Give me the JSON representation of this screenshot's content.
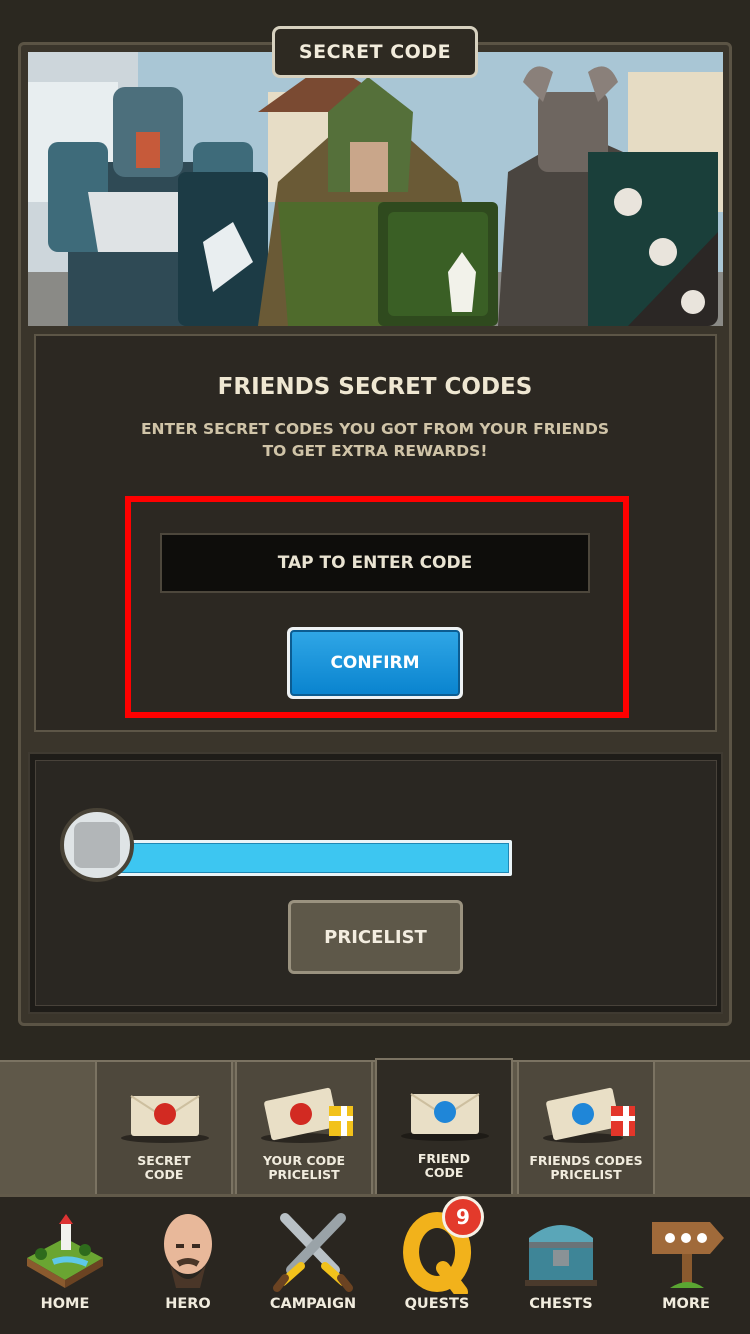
{
  "header": {
    "title": "SECRET CODE"
  },
  "friends_codes": {
    "title": "FRIENDS SECRET CODES",
    "subtitle_line1": "ENTER SECRET CODES YOU GOT FROM YOUR FRIENDS",
    "subtitle_line2": "TO GET EXTRA REWARDS!",
    "input_placeholder": "TAP TO ENTER CODE",
    "confirm_label": "CONFIRM"
  },
  "progress": {
    "fraction": 1.0
  },
  "pricelist": {
    "button_label": "PRICELIST"
  },
  "subtabs": [
    {
      "line1": "SECRET",
      "line2": "CODE",
      "seal": "red",
      "gift": false
    },
    {
      "line1": "YOUR CODE",
      "line2": "PRICELIST",
      "seal": "red",
      "gift": true
    },
    {
      "line1": "FRIEND",
      "line2": "CODE",
      "seal": "blue",
      "gift": false,
      "active": true
    },
    {
      "line1": "FRIENDS CODES",
      "line2": "PRICELIST",
      "seal": "blue",
      "gift": true
    }
  ],
  "nav": {
    "home": "HOME",
    "hero": "HERO",
    "campaign": "CAMPAIGN",
    "quests": "QUESTS",
    "quests_badge": "9",
    "chests": "CHESTS",
    "more": "MORE"
  },
  "colors": {
    "accent_blue": "#1a94dc",
    "progress_blue": "#3dc6f1",
    "highlight_red": "#ff0000",
    "badge_red": "#e33a2b"
  }
}
